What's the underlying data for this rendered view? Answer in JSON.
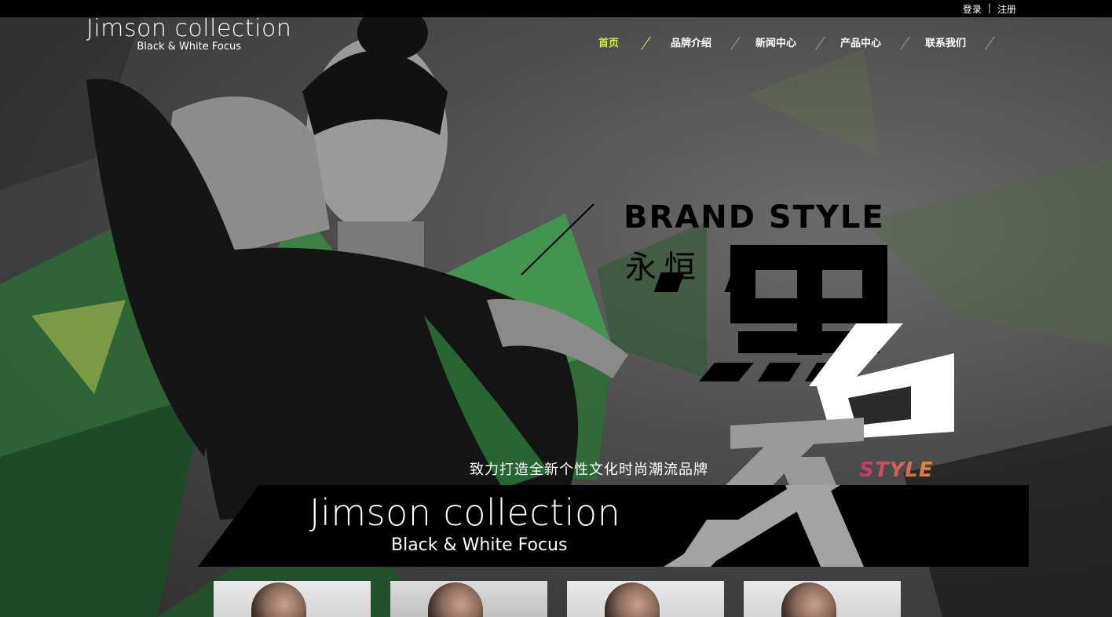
{
  "topbar": {
    "login": "登录",
    "separator": "|",
    "register": "注册"
  },
  "logo": {
    "name": "Jimson collection",
    "tagline": "Black & White Focus"
  },
  "nav": {
    "items": [
      {
        "label": "首页",
        "active": true
      },
      {
        "label": "品牌介绍",
        "active": false
      },
      {
        "label": "新闻中心",
        "active": false
      },
      {
        "label": "产品中心",
        "active": false
      },
      {
        "label": "联系我们",
        "active": false
      }
    ],
    "active_color": "#d6ef3f"
  },
  "hero": {
    "brand_style": "BRAND STYLE",
    "yongheng": "永恒",
    "slogan": "致力打造全新个性文化时尚潮流品牌",
    "style_word": "STYLE",
    "banner_name": "Jimson collection",
    "banner_tagline": "Black & White Focus"
  },
  "thumbnails": [
    {
      "id": "thumb-1"
    },
    {
      "id": "thumb-2"
    },
    {
      "id": "thumb-3"
    },
    {
      "id": "thumb-4"
    }
  ],
  "colors": {
    "accent": "#d6ef3f",
    "green": "#2f7a3a",
    "bar": "#000000"
  }
}
